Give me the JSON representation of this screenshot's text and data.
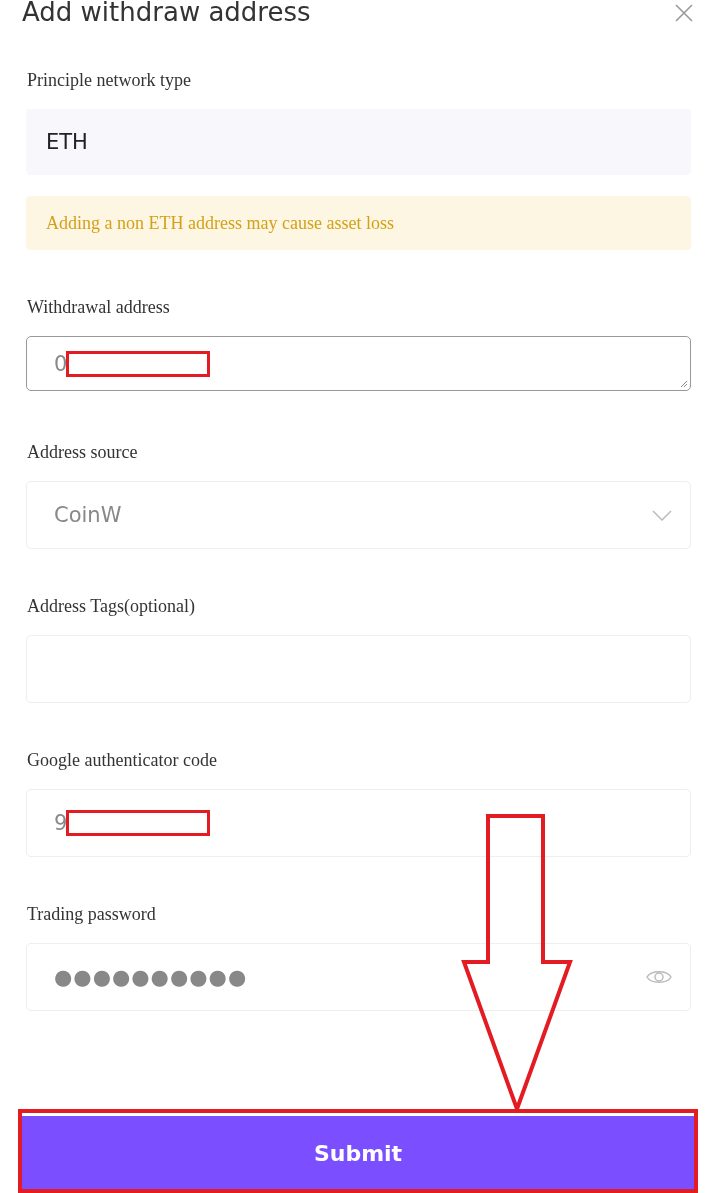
{
  "title": "Add withdraw address",
  "fields": [
    {
      "label": "Principle network type",
      "kind": "static",
      "value": "ETH"
    },
    {
      "kind": "warning",
      "value": "Adding a non ETH address may cause asset loss"
    },
    {
      "label": "Withdrawal address",
      "kind": "textarea",
      "value": "0",
      "redacted": true
    },
    {
      "label": "Address source",
      "kind": "select",
      "value": "CoinW"
    },
    {
      "label": "Address Tags(optional)",
      "kind": "text"
    },
    {
      "label": "Google authenticator code",
      "kind": "text",
      "value": "9",
      "redacted": true
    },
    {
      "label": "Trading password",
      "kind": "password",
      "value": "●●●●●●●●●●"
    }
  ],
  "submit": "Submit",
  "annotations": {
    "arrow": true,
    "highlight": true
  }
}
